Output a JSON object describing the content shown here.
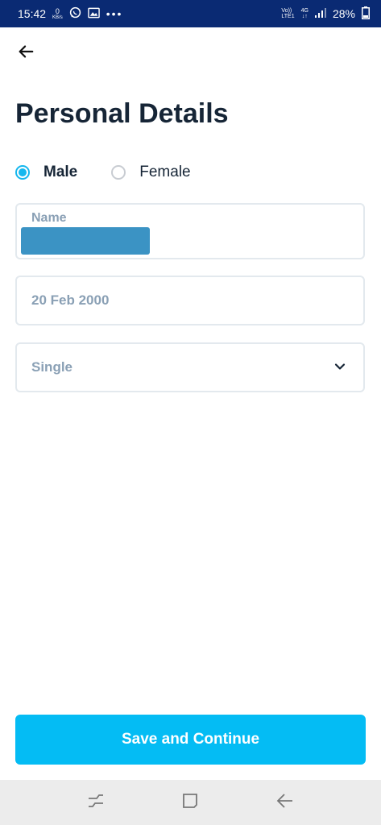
{
  "status_bar": {
    "time": "15:42",
    "net_speed_value": "0",
    "net_speed_unit": "KB/s",
    "volte_top": "Vo))",
    "volte_bottom": "LTE1",
    "network_type": "4G",
    "network_arrows": "↓↑",
    "battery": "28%",
    "icons": [
      "whatsapp-icon",
      "gallery-icon",
      "more-dots-icon",
      "signal-icon",
      "battery-icon"
    ]
  },
  "header": {
    "back_icon": "arrow-left-icon",
    "title": "Personal Details"
  },
  "gender": {
    "options": [
      {
        "label": "Male",
        "selected": true
      },
      {
        "label": "Female",
        "selected": false
      }
    ]
  },
  "form": {
    "name_label": "Name",
    "name_value_redacted": true,
    "dob_value": "20 Feb 2000",
    "marital_status_value": "Single",
    "dropdown_icon": "chevron-down-icon"
  },
  "actions": {
    "save_label": "Save and Continue"
  },
  "nav_bar": {
    "icons": [
      "recent-apps-icon",
      "home-icon",
      "back-icon"
    ]
  },
  "colors": {
    "status_bar": "#0a2a73",
    "accent": "#15b7ee",
    "button": "#04bcf4",
    "title_text": "#162536",
    "placeholder_text": "#8aa0b5",
    "field_border": "#e3e9ee",
    "redaction": "#3b93c4",
    "nav_bar": "#ececec"
  }
}
